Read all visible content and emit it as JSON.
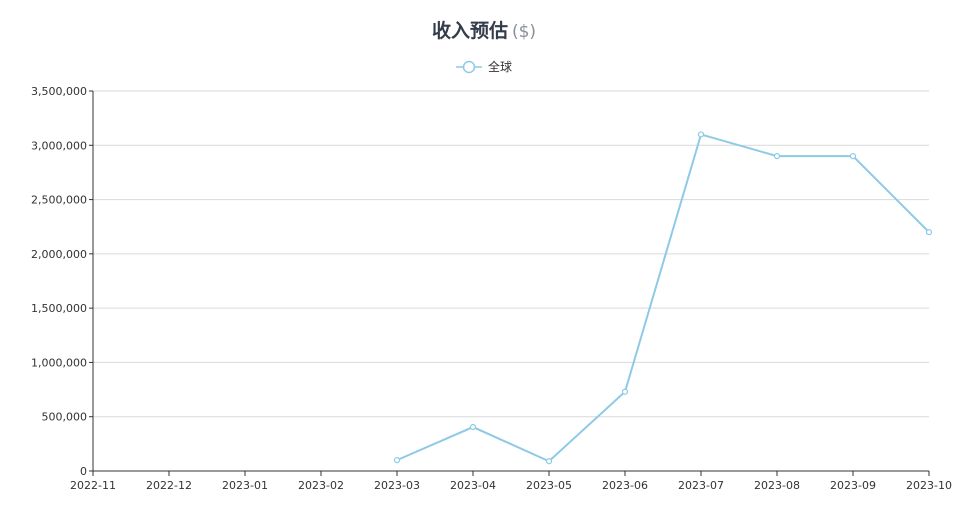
{
  "chart_data": {
    "type": "line",
    "title": "收入预估",
    "title_unit": "($)",
    "categories": [
      "2022-11",
      "2022-12",
      "2023-01",
      "2023-02",
      "2023-03",
      "2023-04",
      "2023-05",
      "2023-06",
      "2023-07",
      "2023-08",
      "2023-09",
      "2023-10"
    ],
    "yticks": [
      "0",
      "500,000",
      "1,000,000",
      "1,500,000",
      "2,000,000",
      "2,500,000",
      "3,000,000",
      "3,500,000"
    ],
    "ylim": [
      0,
      3500000
    ],
    "grid": true,
    "legend_position": "top-center",
    "series": [
      {
        "name": "全球",
        "color": "#8ecae6",
        "values": [
          null,
          null,
          null,
          null,
          100000,
          405000,
          90000,
          730000,
          3100000,
          2900000,
          2900000,
          2200000
        ]
      }
    ]
  }
}
